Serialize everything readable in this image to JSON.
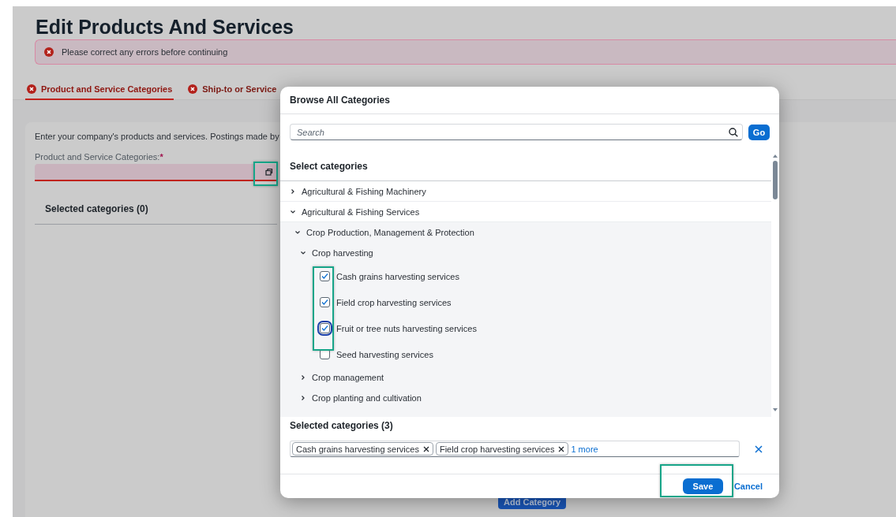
{
  "page": {
    "title": "Edit Products And Services",
    "error_banner": "Please correct any errors before continuing",
    "tabs": [
      {
        "label": "Product and Service Categories",
        "selected": true,
        "error": true
      },
      {
        "label": "Ship-to or Service",
        "selected": false,
        "error": true
      }
    ],
    "description": "Enter your company's products and services. Postings made by",
    "field": {
      "label": "Product and Service Categories:",
      "required": "*"
    },
    "selected_heading": "Selected categories (0)",
    "add_button": "Add Category"
  },
  "dialog": {
    "title": "Browse All Categories",
    "search": {
      "placeholder": "Search"
    },
    "go_button": "Go",
    "section_title": "Select categories",
    "tree": [
      {
        "kind": "branch",
        "label": "Agricultural & Fishing Machinery",
        "expanded": false
      },
      {
        "kind": "branch",
        "label": "Agricultural & Fishing Services",
        "expanded": true,
        "children": [
          {
            "kind": "branch",
            "label": "Crop Production, Management & Protection",
            "expanded": true,
            "children": [
              {
                "kind": "branch",
                "label": "Crop harvesting",
                "expanded": true,
                "children": [
                  {
                    "kind": "checkbox",
                    "label": "Cash grains harvesting services",
                    "checked": true,
                    "focused": false
                  },
                  {
                    "kind": "checkbox",
                    "label": "Field crop harvesting services",
                    "checked": true,
                    "focused": false
                  },
                  {
                    "kind": "checkbox",
                    "label": "Fruit or tree nuts harvesting services",
                    "checked": true,
                    "focused": true
                  },
                  {
                    "kind": "checkbox",
                    "label": "Seed harvesting services",
                    "checked": false,
                    "focused": false
                  }
                ]
              },
              {
                "kind": "branch",
                "label": "Crop management",
                "expanded": false
              },
              {
                "kind": "branch",
                "label": "Crop planting and cultivation",
                "expanded": false
              }
            ]
          }
        ]
      }
    ],
    "selected_heading": "Selected categories (3)",
    "tokens": [
      {
        "label": "Cash grains harvesting services"
      },
      {
        "label": "Field crop harvesting services"
      }
    ],
    "more_link": "1 more",
    "save_button": "Save",
    "cancel_button": "Cancel"
  }
}
